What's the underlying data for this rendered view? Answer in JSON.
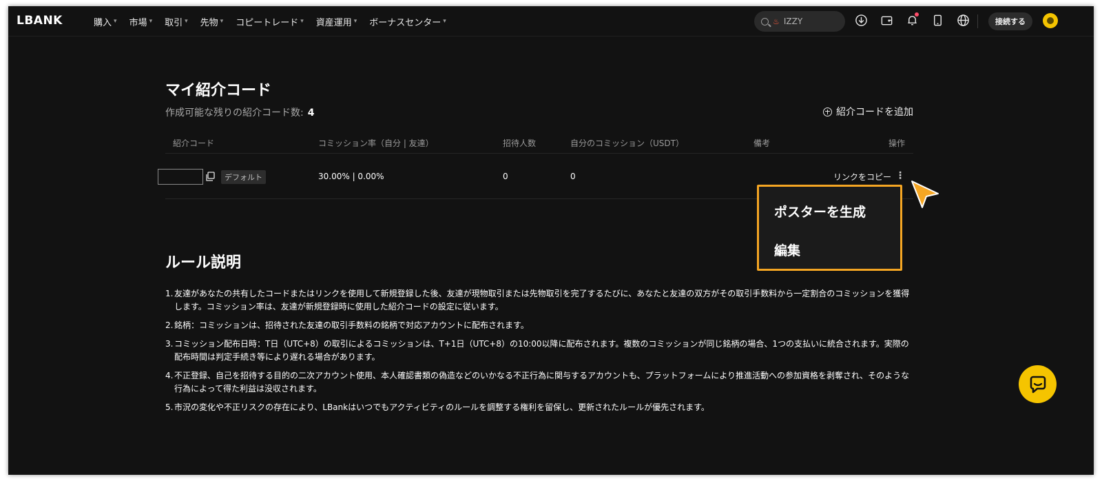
{
  "header": {
    "logo": "LBANK",
    "nav": [
      {
        "label": "購入"
      },
      {
        "label": "市場"
      },
      {
        "label": "取引"
      },
      {
        "label": "先物"
      },
      {
        "label": "コピートレード"
      },
      {
        "label": "資産運用"
      },
      {
        "label": "ボーナスセンター"
      }
    ],
    "search": {
      "query": "IZZY"
    },
    "connect_label": "接続する",
    "icons": [
      "download-icon",
      "wallet-icon",
      "bell-icon",
      "phone-icon",
      "globe-icon"
    ],
    "accent": "#f5c400",
    "notification_color": "#ff4d6a"
  },
  "referral": {
    "title": "マイ紹介コード",
    "remaining_label": "作成可能な残りの紹介コード数:",
    "remaining_count": "4",
    "add_code_label": "紹介コードを追加",
    "columns": [
      "紹介コード",
      "コミッション率（自分 | 友達）",
      "招待人数",
      "自分のコミッション（USDT）",
      "備考",
      "操作"
    ],
    "rows": [
      {
        "code": "",
        "tag": "デフォルト",
        "rate": "30.00% | 0.00%",
        "invited": "0",
        "commission": "0",
        "note": "",
        "action": "リンクをコピー"
      }
    ]
  },
  "menu": {
    "items": [
      "ポスターを生成",
      "編集"
    ],
    "highlight_color": "#f5a623"
  },
  "rules": {
    "title": "ルール説明",
    "items": [
      {
        "num": "1.",
        "text": "友達があなたの共有したコードまたはリンクを使用して新規登録した後、友達が現物取引または先物取引を完了するたびに、あなたと友達の双方がその取引手数料から一定割合のコミッションを獲得します。コミッション率は、友達が新規登録時に使用した紹介コードの設定に従います。"
      },
      {
        "num": "2.",
        "text": "銘柄：コミッションは、招待された友達の取引手数料の銘柄で対応アカウントに配布されます。"
      },
      {
        "num": "3.",
        "text": "コミッション配布日時：T日（UTC+8）の取引によるコミッションは、T+1日（UTC+8）の10:00以降に配布されます。複数のコミッションが同じ銘柄の場合、1つの支払いに統合されます。実際の配布時間は判定手続き等により遅れる場合があります。"
      },
      {
        "num": "4.",
        "text": "不正登録、自己を招待する目的の二次アカウント使用、本人確認書類の偽造などのいかなる不正行為に関与するアカウントも、プラットフォームにより推進活動への参加資格を剥奪され、そのような行為によって得た利益は没収されます。"
      },
      {
        "num": "5.",
        "text": "市況の変化や不正リスクの存在により、LBankはいつでもアクティビティのルールを調整する権利を留保し、更新されたルールが優先されます。"
      }
    ]
  }
}
